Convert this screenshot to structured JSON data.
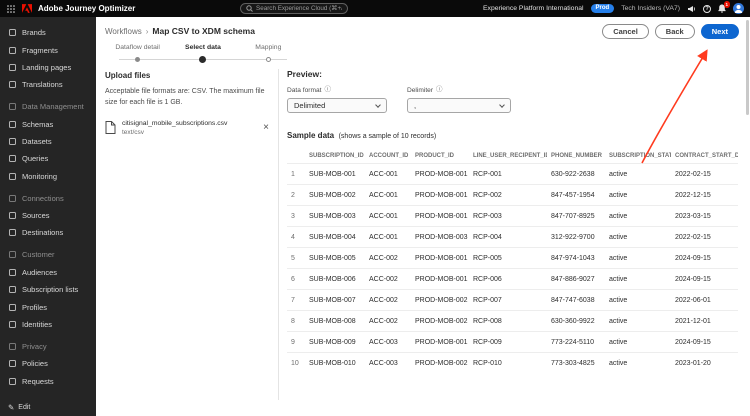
{
  "colors": {
    "accent_blue": "#0d66d0",
    "badge_blue": "#2680eb",
    "adobe_red": "#eb1000",
    "annotation_red": "#ff3b1f"
  },
  "header": {
    "app_title": "Adobe Journey Optimizer",
    "search_placeholder": "Search Experience Cloud (⌘+/)",
    "org_name": "Experience Platform International",
    "env_badge": "Prod",
    "sandbox_name": "Tech Insiders (VA7)",
    "notification_count": "1"
  },
  "sidebar": {
    "items": [
      {
        "label": "Brands",
        "type": "item"
      },
      {
        "label": "Fragments",
        "type": "item"
      },
      {
        "label": "Landing pages",
        "type": "item"
      },
      {
        "label": "Translations",
        "type": "item"
      },
      {
        "label": "Data Management",
        "type": "section"
      },
      {
        "label": "Schemas",
        "type": "item"
      },
      {
        "label": "Datasets",
        "type": "item"
      },
      {
        "label": "Queries",
        "type": "item"
      },
      {
        "label": "Monitoring",
        "type": "item"
      },
      {
        "label": "Connections",
        "type": "section"
      },
      {
        "label": "Sources",
        "type": "item"
      },
      {
        "label": "Destinations",
        "type": "item"
      },
      {
        "label": "Customer",
        "type": "section"
      },
      {
        "label": "Audiences",
        "type": "item"
      },
      {
        "label": "Subscription lists",
        "type": "item"
      },
      {
        "label": "Profiles",
        "type": "item"
      },
      {
        "label": "Identities",
        "type": "item"
      },
      {
        "label": "Privacy",
        "type": "section"
      },
      {
        "label": "Policies",
        "type": "item"
      },
      {
        "label": "Requests",
        "type": "item"
      }
    ],
    "edit_label": "Edit"
  },
  "breadcrumb": {
    "parent": "Workflows",
    "separator": "›",
    "current": "Map CSV to XDM schema"
  },
  "actions": {
    "cancel": "Cancel",
    "back": "Back",
    "next": "Next"
  },
  "stepper": {
    "steps": [
      {
        "label": "Dataflow detail",
        "state": "completed"
      },
      {
        "label": "Select data",
        "state": "current"
      },
      {
        "label": "Mapping",
        "state": "upcoming"
      }
    ]
  },
  "upload": {
    "title": "Upload files",
    "hint": "Acceptable file formats are: CSV. The maximum file size for each file is 1 GB.",
    "file_name": "citisignal_mobile_subscriptions.csv",
    "file_type": "text/csv"
  },
  "preview": {
    "title": "Preview:",
    "data_format_label": "Data format",
    "data_format_value": "Delimited",
    "delimiter_label": "Delimiter",
    "delimiter_value": ",",
    "sample_title": "Sample data",
    "sample_note": "(shows a sample of 10 records)"
  },
  "table": {
    "columns": [
      "",
      "SUBSCRIPTION_ID",
      "ACCOUNT_ID",
      "PRODUCT_ID",
      "LINE_USER_RECIPENT_ID",
      "PHONE_NUMBER",
      "SUBSCRIPTION_STATUS",
      "CONTRACT_START_DATE"
    ],
    "rows": [
      {
        "num": "1",
        "cells": [
          "SUB-MOB-001",
          "ACC-001",
          "PROD-MOB-001",
          "RCP-001",
          "630-922-2638",
          "active",
          "2022-02-15"
        ]
      },
      {
        "num": "2",
        "cells": [
          "SUB-MOB-002",
          "ACC-001",
          "PROD-MOB-001",
          "RCP-002",
          "847-457-1954",
          "active",
          "2022-12-15"
        ]
      },
      {
        "num": "3",
        "cells": [
          "SUB-MOB-003",
          "ACC-001",
          "PROD-MOB-001",
          "RCP-003",
          "847-707-8925",
          "active",
          "2023-03-15"
        ]
      },
      {
        "num": "4",
        "cells": [
          "SUB-MOB-004",
          "ACC-001",
          "PROD-MOB-003",
          "RCP-004",
          "312-922-9700",
          "active",
          "2022-02-15"
        ]
      },
      {
        "num": "5",
        "cells": [
          "SUB-MOB-005",
          "ACC-002",
          "PROD-MOB-001",
          "RCP-005",
          "847-974-1043",
          "active",
          "2024-09-15"
        ]
      },
      {
        "num": "6",
        "cells": [
          "SUB-MOB-006",
          "ACC-002",
          "PROD-MOB-001",
          "RCP-006",
          "847-886-9027",
          "active",
          "2024-09-15"
        ]
      },
      {
        "num": "7",
        "cells": [
          "SUB-MOB-007",
          "ACC-002",
          "PROD-MOB-002",
          "RCP-007",
          "847-747-6038",
          "active",
          "2022-06-01"
        ]
      },
      {
        "num": "8",
        "cells": [
          "SUB-MOB-008",
          "ACC-002",
          "PROD-MOB-002",
          "RCP-008",
          "630-360-9922",
          "active",
          "2021-12-01"
        ]
      },
      {
        "num": "9",
        "cells": [
          "SUB-MOB-009",
          "ACC-003",
          "PROD-MOB-001",
          "RCP-009",
          "773-224-5110",
          "active",
          "2024-09-15"
        ]
      },
      {
        "num": "10",
        "cells": [
          "SUB-MOB-010",
          "ACC-003",
          "PROD-MOB-002",
          "RCP-010",
          "773-303-4825",
          "active",
          "2023-01-20"
        ]
      }
    ]
  }
}
